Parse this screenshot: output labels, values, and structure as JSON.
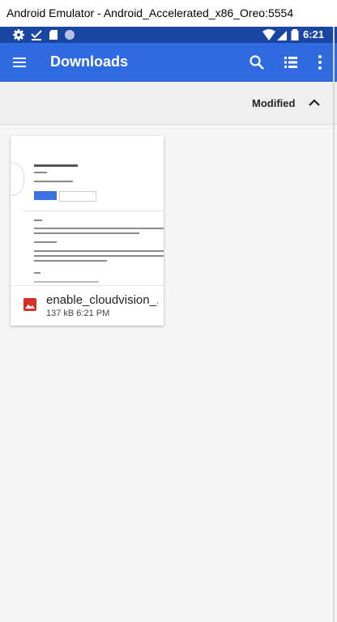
{
  "window": {
    "title": "Android Emulator - Android_Accelerated_x86_Oreo:5554"
  },
  "status_bar": {
    "time": "6:21",
    "left_icons": [
      "gear-icon",
      "check-download-icon",
      "sd-card-icon",
      "circle-icon"
    ],
    "right_icons": [
      "wifi-icon",
      "signal-icon",
      "battery-icon"
    ]
  },
  "app_bar": {
    "title": "Downloads",
    "actions": [
      "search-icon",
      "list-view-icon",
      "more-vert-icon"
    ],
    "color": "#2f6ae0"
  },
  "sort_bar": {
    "label": "Modified",
    "direction": "ascending"
  },
  "files": [
    {
      "name": "enable_cloudvision_...",
      "meta": "137 kB 6:21 PM",
      "icon": "image-file-icon",
      "icon_color": "#d93025"
    }
  ]
}
